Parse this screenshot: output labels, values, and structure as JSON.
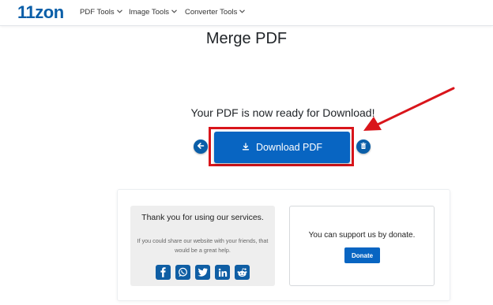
{
  "brand": {
    "logo": "11zon"
  },
  "nav": {
    "items": [
      {
        "label": "PDF Tools",
        "icon": "chevron-down-icon"
      },
      {
        "label": "Image Tools",
        "icon": "chevron-down-icon"
      },
      {
        "label": "Converter Tools",
        "icon": "chevron-down-icon"
      }
    ]
  },
  "main": {
    "title": "Merge PDF",
    "ready_text": "Your PDF is now ready for Download!",
    "download_label": "Download PDF",
    "download_icon": "download-icon",
    "back_icon": "arrow-left-icon",
    "delete_icon": "trash-icon",
    "highlight_color": "#d9151b"
  },
  "thanks": {
    "title": "Thank you for using our services.",
    "subtitle": "If you could share our website with your friends, that would be a great help.",
    "social": [
      "facebook-icon",
      "whatsapp-icon",
      "twitter-icon",
      "linkedin-icon",
      "reddit-icon"
    ]
  },
  "support": {
    "text": "You can support us by donate.",
    "donate_label": "Donate"
  },
  "colors": {
    "accent": "#0865c2",
    "brand": "#0a5ea8",
    "annotation": "#d9151b"
  }
}
